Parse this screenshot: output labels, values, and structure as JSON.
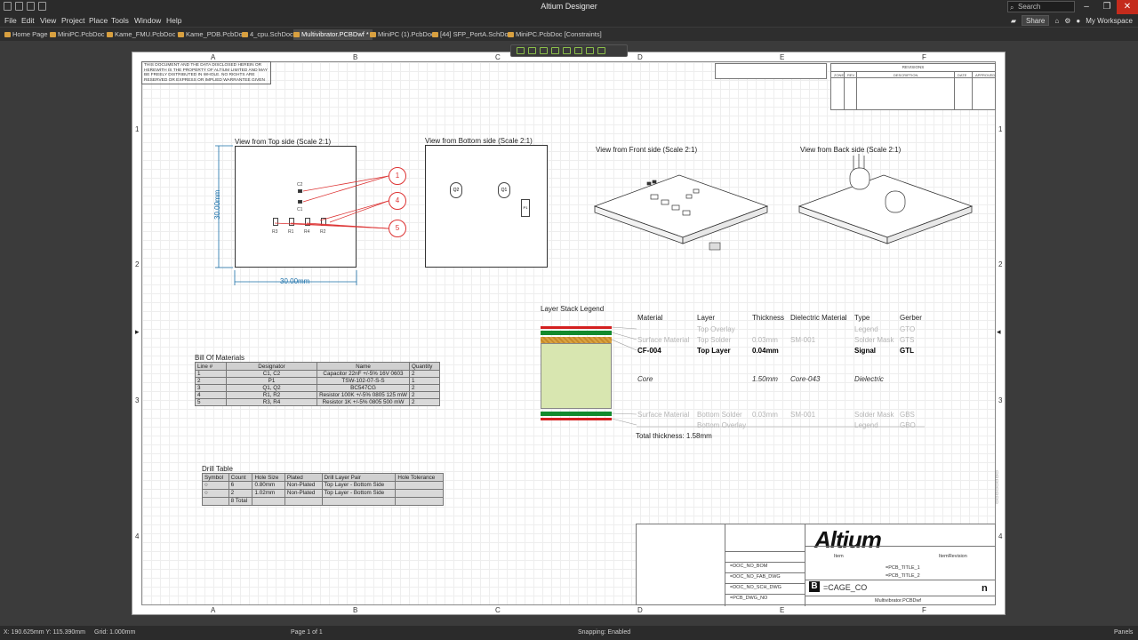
{
  "app_title": "Altium Designer",
  "search_placeholder": "Search",
  "menu": [
    "File",
    "Edit",
    "View",
    "Project",
    "Place",
    "Tools",
    "Window",
    "Help"
  ],
  "menu_right": {
    "share": "Share",
    "workspace": "My Workspace"
  },
  "tabs": [
    {
      "label": "Home Page",
      "active": false
    },
    {
      "label": "MiniPC.PcbDoc *",
      "active": false
    },
    {
      "label": "Kame_FMU.PcbDoc *",
      "active": false
    },
    {
      "label": "Kame_PDB.PcbDoc",
      "active": false
    },
    {
      "label": "4_cpu.SchDoc",
      "active": false
    },
    {
      "label": "Multivibrator.PCBDwf *",
      "active": true
    },
    {
      "label": "MiniPC (1).PcbDoc",
      "active": false
    },
    {
      "label": "[44] SFP_PortA.SchDoc",
      "active": false
    },
    {
      "label": "MiniPC.PcbDoc [Constraints]",
      "active": false
    }
  ],
  "zones": {
    "cols": [
      "A",
      "B",
      "C",
      "D",
      "E",
      "F"
    ],
    "rows": [
      "1",
      "2",
      "3",
      "4"
    ]
  },
  "notice_text": "THIS DOCUMENT AND THE DATA DISCLOSED HEREIN OR HEREWITH IS THE PROPERTY OF ALTIUM LIMITED AND MAY BE FREELY DISTRIBUTED IN WHOLE. NO RIGHTS ARE RESERVED OR EXPRESS OR IMPLIED WARRANTEE GIVEN",
  "views": {
    "top": "View from Top side (Scale 2:1)",
    "bottom": "View from Bottom side (Scale 2:1)",
    "front": "View from Front side (Scale 2:1)",
    "back": "View from Back side (Scale 2:1)"
  },
  "dimensions": {
    "width": "30.00mm",
    "height": "30.00mm"
  },
  "callouts": [
    "1",
    "4",
    "5"
  ],
  "top_components": [
    "C2",
    "C1",
    "R3",
    "R1",
    "R4",
    "R2"
  ],
  "bottom_components": [
    "Q2",
    "Q1",
    "P1"
  ],
  "bom": {
    "title": "Bill Of Materials",
    "headers": [
      "Line #",
      "Designator",
      "Name",
      "Quantity"
    ],
    "rows": [
      [
        "1",
        "C1, C2",
        "Capacitor 22nF +/-5% 16V 0603",
        "2"
      ],
      [
        "2",
        "P1",
        "TSW-102-07-S-S",
        "1"
      ],
      [
        "3",
        "Q1, Q2",
        "BC547CG",
        "2"
      ],
      [
        "4",
        "R1, R2",
        "Resistor 100K +/-5% 0805 125 mW",
        "2"
      ],
      [
        "5",
        "R3, R4",
        "Resistor 1K +/-5% 0805 500 mW",
        "2"
      ]
    ]
  },
  "drill": {
    "title": "Drill Table",
    "headers": [
      "Symbol",
      "Count",
      "Hole Size",
      "Plated",
      "Drill Layer Pair",
      "Hole Tolerance"
    ],
    "rows": [
      [
        "○",
        "6",
        "0.80mm",
        "Non-Plated",
        "Top Layer - Bottom Side",
        ""
      ],
      [
        "○",
        "2",
        "1.02mm",
        "Non-Plated",
        "Top Layer - Bottom Side",
        ""
      ],
      [
        "",
        "8 Total",
        "",
        "",
        "",
        ""
      ]
    ]
  },
  "stack": {
    "title": "Layer Stack Legend",
    "headers": [
      "Material",
      "Layer",
      "Thickness",
      "Dielectric Material",
      "Type",
      "Gerber"
    ],
    "rows": [
      {
        "material": "",
        "layer": "Top Overlay",
        "thickness": "",
        "dielectric": "",
        "type": "Legend",
        "gerber": "GTO",
        "style": "gray"
      },
      {
        "material": "Surface Material",
        "layer": "Top Solder",
        "thickness": "0.03mm",
        "dielectric": "SM-001",
        "type": "Solder Mask",
        "gerber": "GTS",
        "style": "gray"
      },
      {
        "material": "CF-004",
        "layer": "Top Layer",
        "thickness": "0.04mm",
        "dielectric": "",
        "type": "Signal",
        "gerber": "GTL",
        "style": "strong"
      },
      {
        "material": "Core",
        "layer": "",
        "thickness": "1.50mm",
        "dielectric": "Core-043",
        "type": "Dielectric",
        "gerber": "",
        "style": "italic"
      },
      {
        "material": "Surface Material",
        "layer": "Bottom Solder",
        "thickness": "0.03mm",
        "dielectric": "SM-001",
        "type": "Solder Mask",
        "gerber": "GBS",
        "style": "gray"
      },
      {
        "material": "",
        "layer": "Bottom Overlay",
        "thickness": "",
        "dielectric": "",
        "type": "Legend",
        "gerber": "GBO",
        "style": "gray"
      }
    ],
    "total": "Total thickness: 1.58mm",
    "colors": {
      "overlay": "#d42020",
      "mask": "#138a2e",
      "copper": "#d9a441",
      "core": "#d8e6b0"
    }
  },
  "revisions_header": "REVISIONS",
  "revision_cols": [
    "ZONE",
    "REV",
    "DESCRIPTION",
    "DATE",
    "APPROVED"
  ],
  "title_block": {
    "logo": "Altium",
    "rows": [
      "=DOC_NO_BOM",
      "=DOC_NO_FAB_DWG",
      "=DOC_NO_SCH_DWG",
      "=PCB_DWG_NO"
    ],
    "titles": [
      "=PCB_TITLE_1",
      "=PCB_TITLE_2"
    ],
    "item": "Item",
    "item_revision": "ItemRevision",
    "size": "B",
    "cage": "=CAGE_CO",
    "filename": "Multivibrator.PCBDwf",
    "rev_letter": "n"
  },
  "status": {
    "coords": "X: 190.625mm  Y: 115.390mm",
    "grid": "Grid: 1.000mm",
    "page": "Page 1 of 1",
    "snapping": "Snapping: Enabled",
    "panels": "Panels"
  }
}
